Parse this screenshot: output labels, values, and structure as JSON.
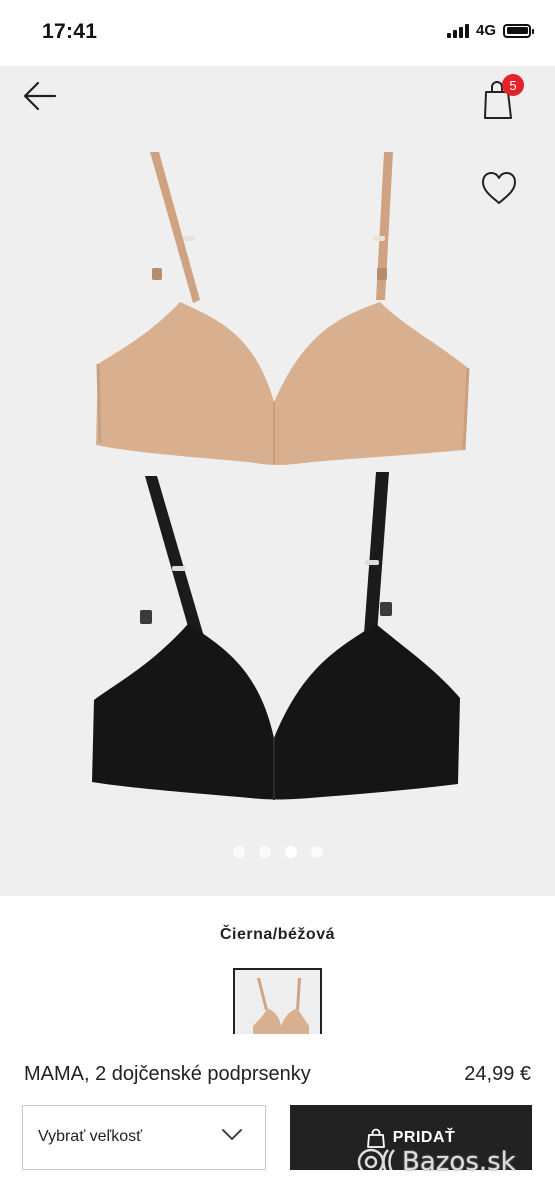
{
  "status_bar": {
    "time": "17:41",
    "network": "4G"
  },
  "gallery": {
    "cart_count": "5",
    "slide_count": 4,
    "active_slide": 3
  },
  "product": {
    "color_name": "Čierna/béžová",
    "name": "MAMA, 2 dojčenské podprsenky",
    "price": "24,99 €"
  },
  "actions": {
    "size_placeholder": "Vybrať veľkosť",
    "add_label": "PRIDAŤ"
  },
  "watermark": {
    "text": "Bazos.sk"
  },
  "colors": {
    "badge": "#e3222c",
    "gallery_bg": "#efefef",
    "button_bg": "#222222",
    "beige": "#d9b08f",
    "black": "#151515"
  }
}
